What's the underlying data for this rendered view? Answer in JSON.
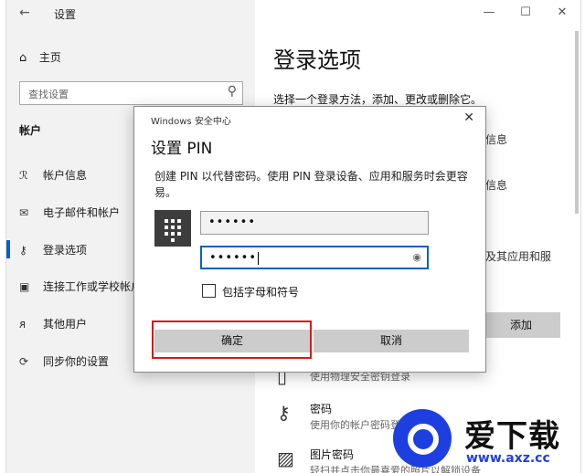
{
  "window": {
    "title": "设置",
    "back": "←",
    "controls": {
      "minimize": "—",
      "maximize": "☐",
      "close": "✕"
    }
  },
  "sidebar": {
    "home_label": "主页",
    "search_placeholder": "查找设置",
    "section": "帐户",
    "items": [
      {
        "label": "帐户信息",
        "icon": "person-card-icon"
      },
      {
        "label": "电子邮件和帐户",
        "icon": "mail-icon"
      },
      {
        "label": "登录选项",
        "icon": "key-icon",
        "active": true
      },
      {
        "label": "连接工作或学校帐户",
        "icon": "briefcase-icon"
      },
      {
        "label": "其他用户",
        "icon": "add-person-icon"
      },
      {
        "label": "同步你的设置",
        "icon": "sync-icon"
      }
    ]
  },
  "main": {
    "title": "登录选项",
    "description": "选择一个登录方法，添加、更改或删除它。",
    "fragment_1": "信息",
    "fragment_2": "信息",
    "fragment_3": "及其应用和服",
    "add_button": "添加",
    "options": [
      {
        "title": "",
        "subtitle": "使用物理安全密钥登录"
      },
      {
        "title": "密码",
        "subtitle": "使用你的帐户密码登录"
      },
      {
        "title": "图片密码",
        "subtitle": "轻扫并点击你最喜爱的照片以解锁设备"
      }
    ]
  },
  "dialog": {
    "app_name": "Windows 安全中心",
    "title": "设置 PIN",
    "description": "创建 PIN 以代替密码。使用 PIN 登录设备、应用和服务时会更容易。",
    "pin_value": "••••••",
    "confirm_value": "••••••",
    "checkbox_label": "包括字母和符号",
    "checkbox_checked": false,
    "ok_button": "确定",
    "cancel_button": "取消"
  },
  "watermark": {
    "name": "爱下载",
    "url": "www.axz.cc"
  }
}
